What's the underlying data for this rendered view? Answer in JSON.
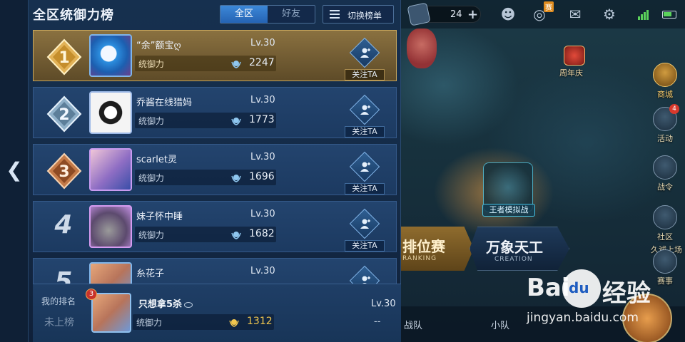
{
  "leaderboard": {
    "title": "全区统御力榜",
    "tabs": [
      {
        "label": "全区",
        "active": true
      },
      {
        "label": "好友",
        "active": false
      }
    ],
    "switch_label": "切换榜单",
    "stat_label": "统御力",
    "follow_label": "关注TA",
    "entries": [
      {
        "rank": "1",
        "name": "“余”额宝ღ",
        "level": "Lv.30",
        "value": "2247",
        "medal": "gold"
      },
      {
        "rank": "2",
        "name": "乔酱在线猎妈",
        "level": "Lv.30",
        "value": "1773",
        "medal": "silver"
      },
      {
        "rank": "3",
        "name": "scarlet灵",
        "level": "Lv.30",
        "value": "1696",
        "medal": "bronze"
      },
      {
        "rank": "4",
        "name": "妹子怀中睡",
        "level": "Lv.30",
        "value": "1682",
        "medal": "none"
      },
      {
        "rank": "5",
        "name": "糸花子",
        "level": "Lv.30",
        "value": "",
        "medal": "none"
      }
    ],
    "my_rank": {
      "title": "我的排名",
      "rank_text": "未上榜",
      "badge": "3",
      "name": "只想拿5杀",
      "level": "Lv.30",
      "value": "1312",
      "dash": "--"
    }
  },
  "background": {
    "currency_count": "24",
    "top_badge": "赛",
    "anniversary": "周年庆",
    "side_buttons": [
      {
        "label": "商城",
        "badge": ""
      },
      {
        "label": "活动",
        "badge": "4"
      },
      {
        "label": "战令",
        "badge": ""
      },
      {
        "label": "社区",
        "badge": ""
      },
      {
        "label": "赛事",
        "badge": ""
      }
    ],
    "community_hint": "久诚上场",
    "mode_tag": "王者模拟战",
    "ranked": {
      "title": "排位赛",
      "sub": "RANKING"
    },
    "creation": {
      "title": "万象天工",
      "sub": "CREATION"
    },
    "bottom": [
      "战队",
      "小队"
    ]
  },
  "watermark": {
    "brand_left": "Bai",
    "brand_right": "经验",
    "url": "jingyan.baidu.com"
  },
  "colors": {
    "gold": "#f1c64e",
    "accent_blue": "#2563b3"
  }
}
